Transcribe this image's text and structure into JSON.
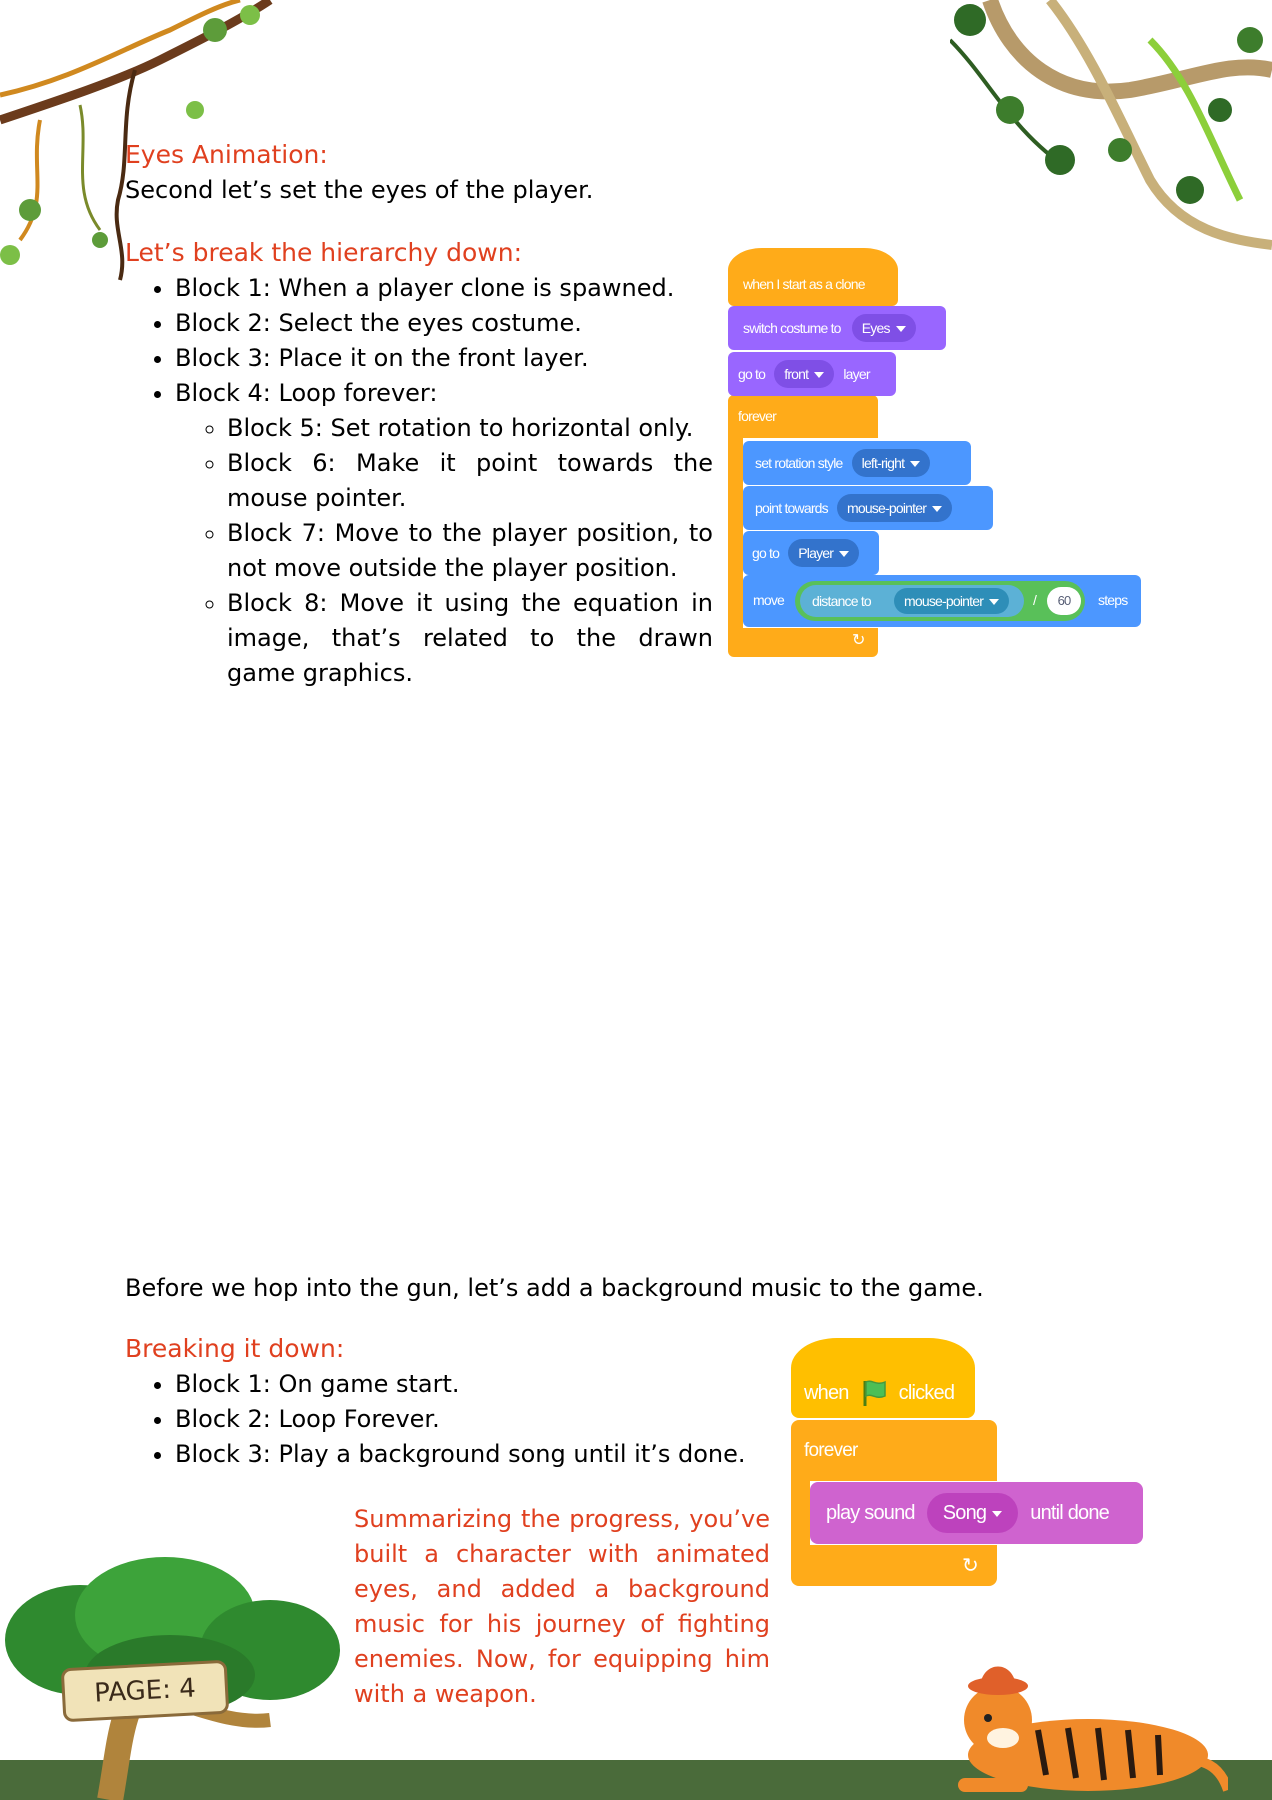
{
  "eyes_section": {
    "heading": "Eyes Animation:",
    "intro": "Second let’s set the eyes of the player.",
    "breakdown_heading": "Let’s break the hierarchy down:",
    "items": [
      "Block 1: When a player clone is spawned.",
      "Block 2: Select the eyes costume.",
      "Block 3: Place it on the front layer.",
      "Block 4: Loop forever:"
    ],
    "sub_items": [
      "Block 5: Set rotation to horizontal only.",
      "Block 6: Make it point towards the mouse pointer.",
      "Block 7: Move to the player position, to not move outside the player position.",
      "Block 8: Move it using the equation in image, that’s related to the drawn game graphics."
    ]
  },
  "eyes_script": {
    "hat": "when I start as a clone",
    "switch_costume": "switch costume to",
    "costume_value": "Eyes",
    "go_to": "go to",
    "layer_value": "front",
    "layer_label": "layer",
    "forever": "forever",
    "set_rotation": "set rotation style",
    "rotation_value": "left-right",
    "point_towards": "point towards",
    "point_value": "mouse-pointer",
    "goto2": "go to",
    "goto2_value": "Player",
    "move": "move",
    "distance_to": "distance to",
    "distance_value": "mouse-pointer",
    "divide": "/",
    "divisor": "60",
    "steps": "steps"
  },
  "music_section": {
    "intro": "Before we hop into the gun, let’s add a background music to the game.",
    "heading": "Breaking it down:",
    "items": [
      "Block 1: On game start.",
      "Block 2: Loop Forever.",
      "Block 3: Play a background song until it’s done."
    ],
    "summary": "Summarizing the progress, you’ve built a character with animated eyes, and added a background music for his journey of fighting enemies. Now, for equipping him with a weapon."
  },
  "music_script": {
    "when": "when",
    "clicked": "clicked",
    "forever": "forever",
    "play_sound": "play sound",
    "sound_value": "Song",
    "until_done": "until done"
  },
  "footer": {
    "page_label": "PAGE: 4"
  },
  "colors": {
    "accent_red": "#e0401f",
    "events_yellow": "#ffbf00",
    "control_orange": "#ffab19",
    "looks_purple": "#9966ff",
    "motion_blue": "#4c97ff",
    "sensing_teal": "#5cb1d6",
    "operators_green": "#59c059",
    "sound_magenta": "#cf63cf",
    "ground_green": "#4a6b3a"
  }
}
